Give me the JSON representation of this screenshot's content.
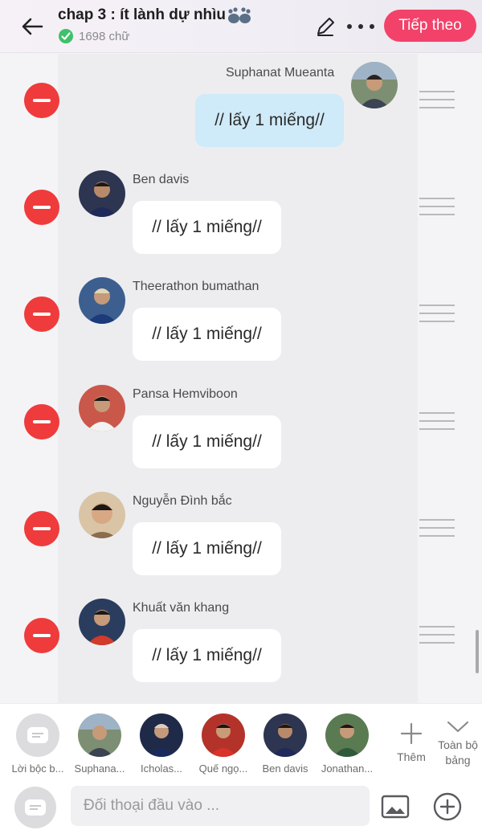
{
  "header": {
    "title": "chap 3 : ít lành dự nhìu",
    "word_count": "1698 chữ",
    "next_label": "Tiếp theo",
    "accent": "#f3426a"
  },
  "messages": [
    {
      "speaker": "Suphanat Mueanta",
      "text": "// lấy 1 miếng//",
      "side": "right"
    },
    {
      "speaker": "Ben davis",
      "text": "// lấy 1 miếng//",
      "side": "left"
    },
    {
      "speaker": "Theerathon bumathan",
      "text": "// lấy 1 miếng//",
      "side": "left"
    },
    {
      "speaker": "Pansa Hemviboon",
      "text": "// lấy 1 miếng//",
      "side": "left"
    },
    {
      "speaker": "Nguyễn Đình bắc",
      "text": "// lấy 1 miếng//",
      "side": "left"
    },
    {
      "speaker": "Khuất văn khang",
      "text": "// lấy 1 miếng//",
      "side": "left"
    }
  ],
  "characters": [
    {
      "label": "Lời bộc b..."
    },
    {
      "label": "Suphana..."
    },
    {
      "label": "Icholas..."
    },
    {
      "label": "Quế ngọ..."
    },
    {
      "label": "Ben davis"
    },
    {
      "label": "Jonathan..."
    }
  ],
  "char_actions": {
    "add_label": "Thêm",
    "all_label": "Toàn bộ bảng"
  },
  "input": {
    "placeholder": "Đối thoại đầu vào ..."
  },
  "colors": {
    "remove": "#ef3b3b",
    "self_bubble": "#cfeaf8"
  }
}
